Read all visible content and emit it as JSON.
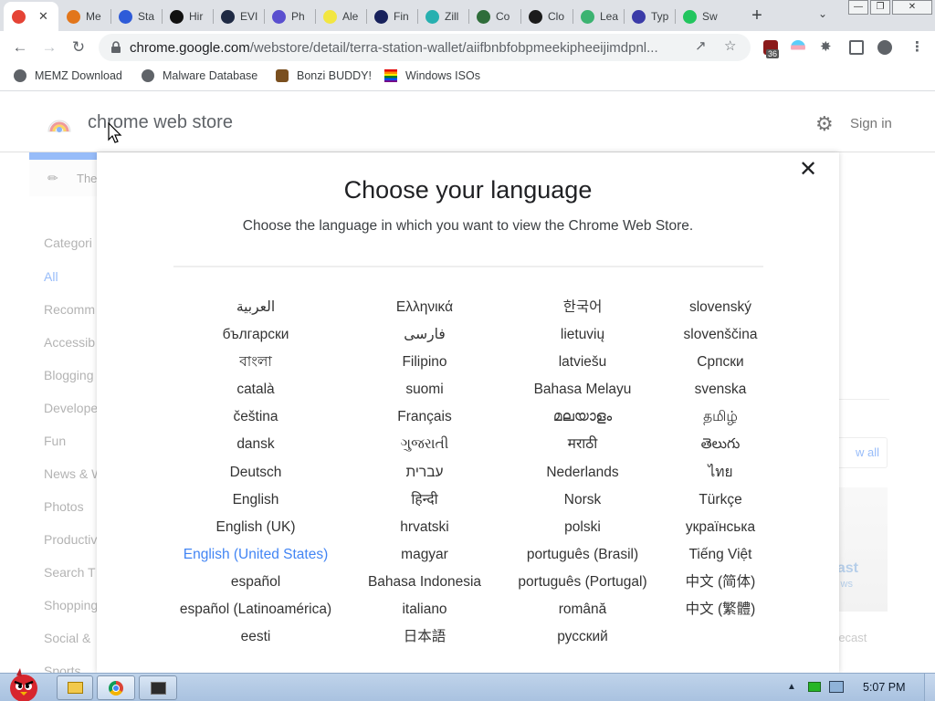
{
  "browser": {
    "tabs": [
      {
        "title": "",
        "color": "#e54335",
        "active": true
      },
      {
        "title": "Me",
        "color": "#e2761b"
      },
      {
        "title": "Sta",
        "color": "#2e5bd8"
      },
      {
        "title": "Hir",
        "color": "#111111"
      },
      {
        "title": "EVI",
        "color": "#1f2a44"
      },
      {
        "title": "Ph",
        "color": "#5a4fcf"
      },
      {
        "title": "Ale",
        "color": "#f2e641"
      },
      {
        "title": "Fin",
        "color": "#17215c"
      },
      {
        "title": "Zill",
        "color": "#27b0b0"
      },
      {
        "title": "Co",
        "color": "#2f6d3a"
      },
      {
        "title": "Clo",
        "color": "#1b1b1b"
      },
      {
        "title": "Lea",
        "color": "#3cb371"
      },
      {
        "title": "Typ",
        "color": "#3b3ba8"
      },
      {
        "title": "Sw",
        "color": "#22c55e"
      }
    ],
    "window_controls": {
      "minimize": "—",
      "restore": "❐",
      "close": "✕"
    },
    "url_host": "chrome.google.com",
    "url_rest": "/webstore/detail/terra-station-wallet/aiifbnbfobpmeekipheeijimdpnl...",
    "extension_badge": "36",
    "bookmarks": [
      {
        "label": "MEMZ Download"
      },
      {
        "label": "Malware Database"
      },
      {
        "label": "Bonzi BUDDY!"
      },
      {
        "label": "Windows ISOs"
      }
    ]
  },
  "store": {
    "name": "chrome web store",
    "sign_in": "Sign in",
    "themes_label": "The",
    "categories_title": "Categori",
    "categories": [
      "All",
      "Recomm",
      "Accessib",
      "Blogging",
      "Develope",
      "Fun",
      "News & W",
      "Photos",
      "Productiv",
      "Search T",
      "Shopping",
      "Social &",
      "Sports"
    ],
    "selected_category": "All",
    "view_all": "w all",
    "promo_title": "ast",
    "promo_sub": "ws",
    "forecast": "recast"
  },
  "dialog": {
    "title": "Choose your language",
    "subtitle": "Choose the language in which you want to view the Chrome Web Store.",
    "close_symbol": "✕",
    "selected_language": "English (United States)",
    "columns": [
      [
        "العربية",
        "български",
        "বাংলা",
        "català",
        "čeština",
        "dansk",
        "Deutsch",
        "English",
        "English (UK)",
        "English (United States)",
        "español",
        "español (Latinoamérica)",
        "eesti"
      ],
      [
        "Ελληνικά",
        "فارسی",
        "Filipino",
        "suomi",
        "Français",
        "ગુજરાતી",
        "עברית",
        "हिन्दी",
        "hrvatski",
        "magyar",
        "Bahasa Indonesia",
        "italiano",
        "日本語"
      ],
      [
        "한국어",
        "lietuvių",
        "latviešu",
        "Bahasa Melayu",
        "മലയാളം",
        "मराठी",
        "Nederlands",
        "Norsk",
        "polski",
        "português (Brasil)",
        "português (Portugal)",
        "română",
        "русский"
      ],
      [
        "slovenský",
        "slovenščina",
        "Српски",
        "svenska",
        "தமிழ்",
        "తెలుగు",
        "ไทย",
        "Türkçe",
        "українська",
        "Tiếng Việt",
        "中文 (简体)",
        "中文 (繁體)"
      ]
    ]
  },
  "taskbar": {
    "clock": "5:07 PM"
  },
  "colors": {
    "accent": "#4285f4",
    "tabstrip": "#dee1e6"
  }
}
